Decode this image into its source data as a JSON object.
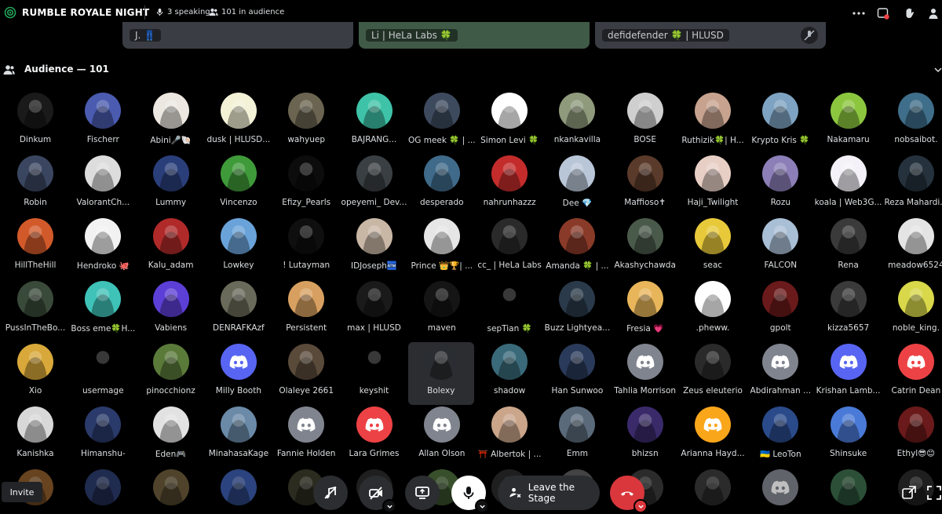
{
  "stage": {
    "title": "RUMBLE ROYALE NIGHT",
    "speaking": "3 speaking",
    "audience_count": "101 in audience"
  },
  "speakers": [
    {
      "name": "J. 👖",
      "color": "#3a3d44"
    },
    {
      "name": "Li | HeLa Labs 🍀",
      "color": "#3f5a46"
    },
    {
      "name": "defidefender 🍀 | HLUSD",
      "color": "#3a3d44"
    }
  ],
  "audience": {
    "label": "Audience — 101"
  },
  "members": [
    {
      "name": "Dinkum",
      "color": "#1a1a1a"
    },
    {
      "name": "Fischerr",
      "color": "#4a5bb0"
    },
    {
      "name": "Abini🎤🐚",
      "color": "#ece7e0"
    },
    {
      "name": "dusk | HLUSD...",
      "color": "#f3f1d6"
    },
    {
      "name": "wahyuep",
      "color": "#6b6450"
    },
    {
      "name": "BAJRANG...",
      "color": "#3ec3a8",
      "badge": "nitro"
    },
    {
      "name": "OG meek 🍀 | ...",
      "color": "#3d4a5e"
    },
    {
      "name": "Simon Levi 🍀",
      "color": "#ffffff"
    },
    {
      "name": "nkankavilla",
      "color": "#8f9a7c"
    },
    {
      "name": "BOSE",
      "color": "#cfcfcf"
    },
    {
      "name": "Ruthizik🍀| H...",
      "color": "#c7a28e"
    },
    {
      "name": "Krypto Kris 🍀",
      "color": "#7ea3c2"
    },
    {
      "name": "Nakamaru",
      "color": "#8cc63f"
    },
    {
      "name": "nobsaibot.",
      "color": "#3f6e8a"
    },
    {
      "name": "Robin",
      "color": "#3a4660"
    },
    {
      "name": "ValorantCh...",
      "color": "#dddddd",
      "badge": "nitro"
    },
    {
      "name": "Lummy",
      "color": "#2a3e7a"
    },
    {
      "name": "Vincenzo",
      "color": "#3f9a3a"
    },
    {
      "name": "Efizy_Pearls",
      "color": "#0c0c0c"
    },
    {
      "name": "opeyemi_ Dev...",
      "color": "#3a3f43"
    },
    {
      "name": "desperado",
      "color": "#3f6a8a"
    },
    {
      "name": "nahrunhazzz",
      "color": "#c42c2c"
    },
    {
      "name": "Dee 💎",
      "color": "#b9c6d8"
    },
    {
      "name": "Maffioso✝",
      "color": "#5a3a2a"
    },
    {
      "name": "Haji_Twilight",
      "color": "#e8cfc6"
    },
    {
      "name": "Rozu",
      "color": "#8c7fb8"
    },
    {
      "name": "koala | Web3G...",
      "color": "#f4f2f8"
    },
    {
      "name": "Reza Mahardi...",
      "color": "#25323d"
    },
    {
      "name": "HillTheHill",
      "color": "#d25a2a"
    },
    {
      "name": "Hendroko 🐙",
      "color": "#f2f2f2"
    },
    {
      "name": "Kalu_adam",
      "color": "#b02a2a"
    },
    {
      "name": "Lowkey",
      "color": "#6aa3d9"
    },
    {
      "name": "! Lutayman",
      "color": "#0f0f0f"
    },
    {
      "name": "IDJoseph🏧",
      "color": "#c9b7a6"
    },
    {
      "name": "Prince 👑🏆| ...",
      "color": "#e6e6e6"
    },
    {
      "name": "cc_ | HeLa Labs",
      "color": "#2a2a2a"
    },
    {
      "name": "Amanda 🍀 | ...",
      "color": "#8a3a28"
    },
    {
      "name": "Akashychawda",
      "color": "#4a5a4a"
    },
    {
      "name": "seac",
      "color": "#e8c93a"
    },
    {
      "name": "FALCON",
      "color": "#a9bfd6"
    },
    {
      "name": "Rena",
      "color": "#3a3a3a"
    },
    {
      "name": "meadow6524",
      "color": "#e4e4e4"
    },
    {
      "name": "PussInTheBo...",
      "color": "#3a4a3a"
    },
    {
      "name": "Boss eme🍀H...",
      "color": "#3fc2b8"
    },
    {
      "name": "Vabiens",
      "color": "#5c3fd6"
    },
    {
      "name": "DENRAFKAzf",
      "color": "#6a6a5a"
    },
    {
      "name": "Persistent",
      "color": "#d8a060"
    },
    {
      "name": "max | HLUSD",
      "color": "#1a1a1a"
    },
    {
      "name": "maven",
      "color": "#151515"
    },
    {
      "name": "sepTian 🍀",
      "color": "#000000"
    },
    {
      "name": "Buzz Lightyea...",
      "color": "#2a3a4a"
    },
    {
      "name": "Fresia 💗",
      "color": "#e8b55a"
    },
    {
      "name": ".pheww.",
      "color": "#ffffff"
    },
    {
      "name": "gpolt",
      "color": "#6a1a1a"
    },
    {
      "name": "kizza5657",
      "color": "#3a3a3a"
    },
    {
      "name": "noble_king.",
      "color": "#d8d84a"
    },
    {
      "name": "Xio",
      "color": "#d8a83a"
    },
    {
      "name": "usermage",
      "color": "#000000"
    },
    {
      "name": "pinocchionz",
      "color": "#5a7a3a"
    },
    {
      "name": "Milly Booth",
      "color": "#5865f2",
      "discord": true
    },
    {
      "name": "Olaleye 2661",
      "color": "#5a4a3a"
    },
    {
      "name": "keyshit",
      "color": "#000000"
    },
    {
      "name": "Bolexy",
      "color": "#2a2d31",
      "selected": true
    },
    {
      "name": "shadow",
      "color": "#3a6a7a"
    },
    {
      "name": "Han Sunwoo",
      "color": "#2a3a5a"
    },
    {
      "name": "Tahlia Morrison",
      "color": "#80848e",
      "discord": true
    },
    {
      "name": "Zeus eleuterio",
      "color": "#2a2a2a"
    },
    {
      "name": "Abdirahman ...",
      "color": "#80848e",
      "discord": true
    },
    {
      "name": "Krishan Lamb...",
      "color": "#5865f2",
      "discord": true
    },
    {
      "name": "Catrin Dean",
      "color": "#ed4245",
      "discord": true
    },
    {
      "name": "Kanishka",
      "color": "#d8d8d8"
    },
    {
      "name": "Himanshu-",
      "color": "#2a3a6a"
    },
    {
      "name": "Eden🎮",
      "color": "#e2e2e2"
    },
    {
      "name": "MinahasaKage",
      "color": "#6a8aa8"
    },
    {
      "name": "Fannie Holden",
      "color": "#80848e",
      "discord": true
    },
    {
      "name": "Lara Grimes",
      "color": "#ed4245",
      "discord": true
    },
    {
      "name": "Allan Olson",
      "color": "#80848e",
      "discord": true
    },
    {
      "name": "⛩️ Albertok | ...",
      "color": "#caa58a"
    },
    {
      "name": "Emm",
      "color": "#5a6a7a"
    },
    {
      "name": "bhizsn",
      "color": "#3a2a6a"
    },
    {
      "name": "Arianna Hayd...",
      "color": "#faa61a",
      "discord": true
    },
    {
      "name": "🇺🇦 LeoTon",
      "color": "#2a4a8a"
    },
    {
      "name": "Shinsuke",
      "color": "#4a7ad8"
    },
    {
      "name": "Ethyl😎😊",
      "color": "#6a1a1a"
    }
  ],
  "partial_row": [
    {
      "color": "#8a5a2a"
    },
    {
      "color": "#2a3a6a"
    },
    {
      "color": "#6a5a3a"
    },
    {
      "color": "#3a5aa8"
    },
    {
      "color": "#3a3a2a"
    },
    {
      "color": "#2a2a2a"
    },
    {
      "color": "#4a6a3a"
    },
    {
      "color": "#2a2a2a"
    },
    {
      "color": "#5a5a5a"
    },
    {
      "color": "#3a3a3a"
    },
    {
      "color": "#3a3a3a"
    },
    {
      "color": "#80848e",
      "discord": true
    },
    {
      "color": "#3a6a4a"
    },
    {
      "color": "#2a2a2a"
    }
  ],
  "controls": {
    "invite": "Invite",
    "leave_stage": "Leave the Stage"
  }
}
